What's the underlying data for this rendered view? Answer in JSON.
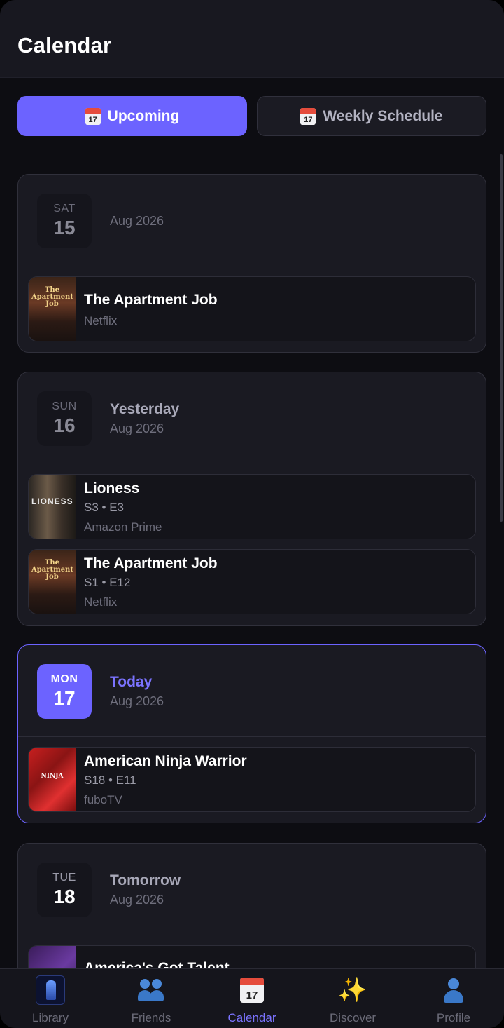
{
  "header": {
    "title": "Calendar"
  },
  "segments": {
    "upcoming": {
      "label": "Upcoming",
      "icon": "calendar-icon",
      "icon_text": "17"
    },
    "weekly": {
      "label": "Weekly Schedule",
      "icon": "calendar-spiral-icon",
      "icon_text": "17"
    }
  },
  "days": [
    {
      "dow": "SAT",
      "num": "15",
      "label": "",
      "month": "Aug 2026",
      "episodes": [
        {
          "title": "The Apartment Job",
          "meta": "",
          "network": "Netflix",
          "poster_text": "The Apartment Job"
        }
      ]
    },
    {
      "dow": "SUN",
      "num": "16",
      "label": "Yesterday",
      "month": "Aug 2026",
      "episodes": [
        {
          "title": "Lioness",
          "meta": "S3 • E3",
          "network": "Amazon Prime",
          "poster_text": "LIONESS"
        },
        {
          "title": "The Apartment Job",
          "meta": "S1 • E12",
          "network": "Netflix",
          "poster_text": "The Apartment Job"
        }
      ]
    },
    {
      "dow": "MON",
      "num": "17",
      "label": "Today",
      "month": "Aug 2026",
      "episodes": [
        {
          "title": "American Ninja Warrior",
          "meta": "S18 • E11",
          "network": "fuboTV",
          "poster_text": "NINJA"
        }
      ]
    },
    {
      "dow": "TUE",
      "num": "18",
      "label": "Tomorrow",
      "month": "Aug 2026",
      "episodes": [
        {
          "title": "America's Got Talent",
          "meta": "",
          "network": "",
          "poster_text": ""
        }
      ]
    }
  ],
  "tabs": [
    {
      "label": "Library",
      "icon": "library-icon"
    },
    {
      "label": "Friends",
      "icon": "friends-icon"
    },
    {
      "label": "Calendar",
      "icon": "calendar-icon",
      "icon_text": "17",
      "active": true
    },
    {
      "label": "Discover",
      "icon": "sparkles-icon",
      "glyph": "✨"
    },
    {
      "label": "Profile",
      "icon": "profile-icon"
    }
  ],
  "colors": {
    "accent": "#6c63ff",
    "background": "#0d0d12",
    "card": "#1a1a22"
  }
}
